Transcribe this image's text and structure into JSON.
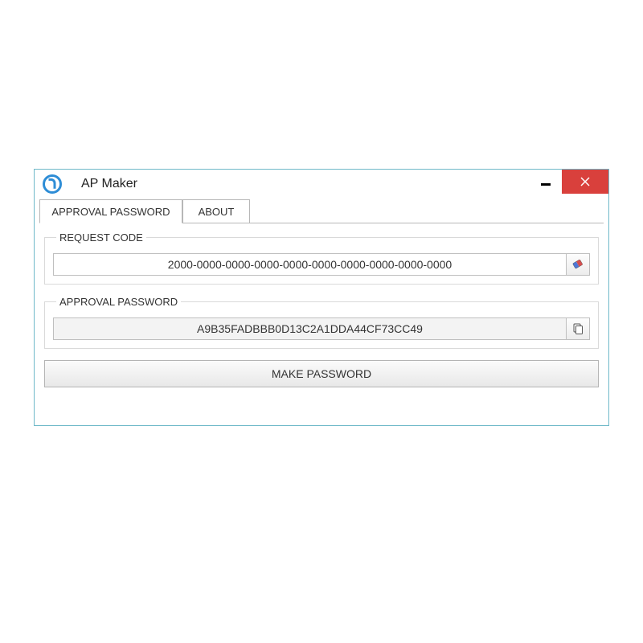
{
  "window": {
    "title": "AP Maker"
  },
  "tabs": {
    "approval_password": "APPROVAL PASSWORD",
    "about": "ABOUT"
  },
  "groups": {
    "request_code": {
      "legend": "REQUEST CODE",
      "value": "2000-0000-0000-0000-0000-0000-0000-0000-0000-0000"
    },
    "approval_password": {
      "legend": "APPROVAL PASSWORD",
      "value": "A9B35FADBBB0D13C2A1DDA44CF73CC49"
    }
  },
  "buttons": {
    "make_password": "MAKE PASSWORD"
  },
  "icons": {
    "eraser": "eraser-icon",
    "copy": "copy-icon"
  }
}
